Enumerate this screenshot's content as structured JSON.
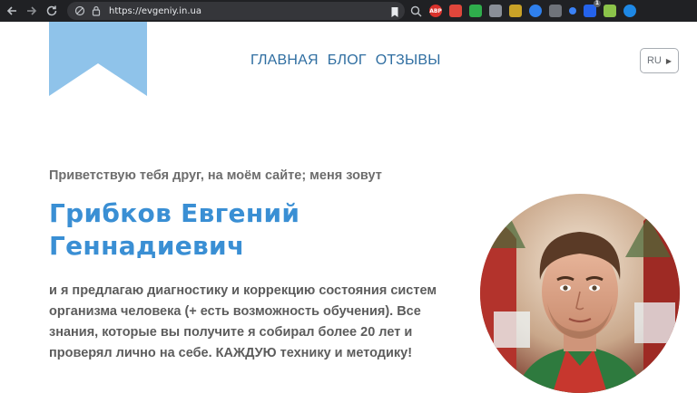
{
  "browser": {
    "url": "https://evgeniy.in.ua",
    "extensions": [
      {
        "name": "abp-extension-icon",
        "label": "ABP",
        "color": "#d9322c"
      },
      {
        "name": "red-extension-icon",
        "label": "",
        "color": "#e0463b"
      },
      {
        "name": "green-extension-icon",
        "label": "",
        "color": "#2fae4c"
      },
      {
        "name": "eyes-extension-icon",
        "label": "",
        "color": "#8a8f98"
      },
      {
        "name": "stripes-extension-icon",
        "label": "",
        "color": "#c9a227"
      },
      {
        "name": "link-extension-icon",
        "label": "",
        "color": "#2f80ed"
      },
      {
        "name": "gray-extension-icon",
        "label": "",
        "color": "#6f737a"
      },
      {
        "name": "blue-dot-extension-icon",
        "label": "",
        "color": "#3b82f6"
      },
      {
        "name": "shield-extension-icon",
        "label": "1",
        "color": "#2563eb"
      },
      {
        "name": "image-extension-icon",
        "label": "",
        "color": "#8bc34a"
      },
      {
        "name": "play-extension-icon",
        "label": "",
        "color": "#1e88e5"
      }
    ]
  },
  "nav": {
    "home": "ГЛАВНАЯ",
    "blog": "БЛОГ",
    "reviews": "ОТЗЫВЫ"
  },
  "language": {
    "current": "RU"
  },
  "hero": {
    "greeting": "Приветствую тебя друг, на моём сайте; меня зовут",
    "name_line1": "Грибков Евгений",
    "name_line2": "Геннадиевич",
    "intro": "и я предлагаю диагностику и коррекцию состояния систем организма человека (+ есть возможность обучения). Все знания, которые вы получите я собирал более 20 лет и проверял лично на себе. КАЖДУЮ технику и методику!"
  },
  "colors": {
    "accent_blue": "#3a8fd4",
    "nav_blue": "#2f6ea1",
    "logo_blue": "#8fc3ea"
  }
}
